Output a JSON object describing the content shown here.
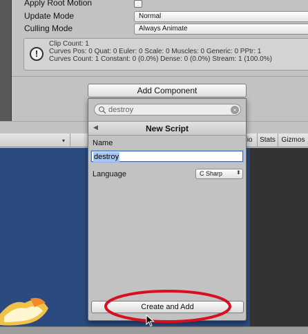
{
  "inspector": {
    "apply_root_motion_label": "Apply Root Motion",
    "update_mode_label": "Update Mode",
    "update_mode_value": "Normal",
    "culling_mode_label": "Culling Mode",
    "culling_mode_value": "Always Animate",
    "info_lines": [
      "Clip Count: 1",
      "Curves Pos: 0 Quat: 0 Euler: 0 Scale: 0 Muscles: 0 Generic: 0 PPtr: 1",
      "Curves Count: 1 Constant: 0 (0.0%) Dense: 0 (0.0%) Stream: 1 (100.0%)"
    ],
    "info_icon_glyph": "!",
    "add_component_label": "Add Component"
  },
  "toolbar": {
    "dropdown_arrow": "▾",
    "tabs": [
      "lio",
      "Stats",
      "Gizmos"
    ]
  },
  "popup": {
    "search_placeholder": "destroy",
    "clear_glyph": "×",
    "back_glyph": "◀",
    "title": "New Script",
    "name_label": "Name",
    "name_value": "destroy",
    "language_label": "Language",
    "language_value": "C Sharp",
    "language_arrows": "⬍",
    "create_button_label": "Create and Add"
  },
  "icons": {
    "search": "search-icon",
    "clear": "clear-icon",
    "back": "back-arrow-icon",
    "warning": "info-icon",
    "cursor": "mouse-cursor-icon"
  },
  "colors": {
    "highlight_ring": "#d6101c",
    "scene_background": "#2b4a80",
    "selection": "#a9c6f0"
  }
}
